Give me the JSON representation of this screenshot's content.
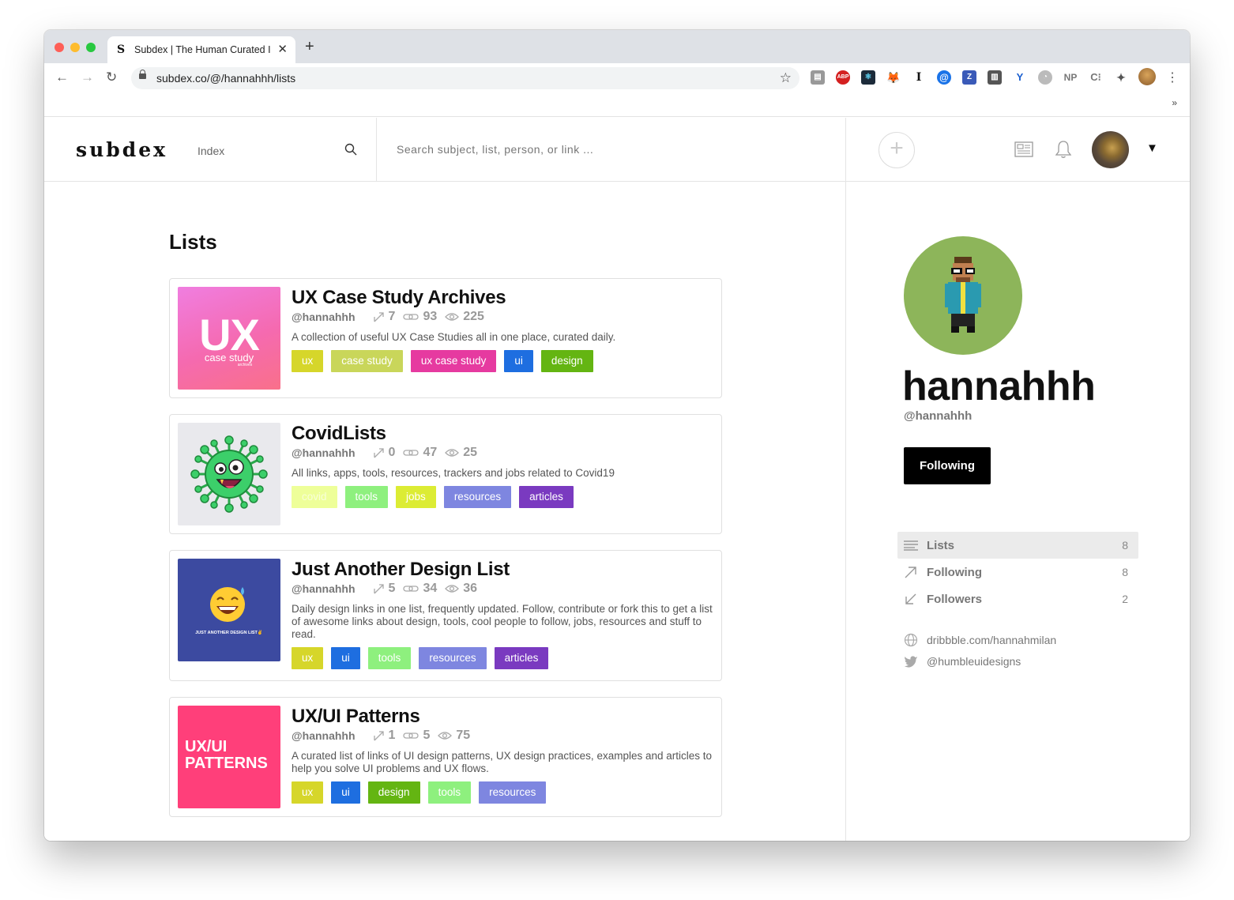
{
  "browser": {
    "tab_title": "Subdex | The Human Curated I",
    "tab_favicon": "S",
    "url": "subdex.co/@/hannahhh/lists",
    "extensions": [
      "suitcase-icon",
      "abp-icon",
      "react-icon",
      "metamask-icon",
      "instapaper-icon",
      "at-icon",
      "zotero-icon",
      "sidebar-icon",
      "y-icon",
      "ghost-icon",
      "np-icon",
      "c-icon",
      "puzzle-icon"
    ],
    "bookmarks_more": "»"
  },
  "header": {
    "logo": "subdex",
    "index_label": "Index",
    "search_placeholder": "Search subject, list, person, or link ...",
    "add_label": "+"
  },
  "main": {
    "heading": "Lists",
    "lists": [
      {
        "title": "UX Case Study Archives",
        "handle": "@hannahhh",
        "forks": "7",
        "links": "93",
        "views": "225",
        "description": "A collection of useful UX Case Studies all in one place, curated daily.",
        "thumb": {
          "big": "UX",
          "sub": "case study",
          "tiny": "archives"
        },
        "tags": [
          {
            "label": "ux",
            "color": "#d6d62a"
          },
          {
            "label": "case study",
            "color": "#c9d65a"
          },
          {
            "label": "ux case study",
            "color": "#e63aa0"
          },
          {
            "label": "ui",
            "color": "#1e6ee0"
          },
          {
            "label": "design",
            "color": "#64b512"
          }
        ]
      },
      {
        "title": "CovidLists",
        "handle": "@hannahhh",
        "forks": "0",
        "links": "47",
        "views": "25",
        "description": "All links, apps, tools, resources, trackers and jobs related to Covid19",
        "tags": [
          {
            "label": "covid",
            "color": "#eeff99"
          },
          {
            "label": "tools",
            "color": "#8ef07e"
          },
          {
            "label": "jobs",
            "color": "#dcec34"
          },
          {
            "label": "resources",
            "color": "#7e86e0"
          },
          {
            "label": "articles",
            "color": "#7a3ac0"
          }
        ]
      },
      {
        "title": "Just Another Design List",
        "handle": "@hannahhh",
        "forks": "5",
        "links": "34",
        "views": "36",
        "description": "Daily design links in one list, frequently updated. Follow, contribute or fork this to get a list of awesome links about design, tools, cool people to follow, jobs, resources and stuff to read.",
        "thumb": {
          "caption": "JUST ANOTHER DESIGN LIST✌"
        },
        "tags": [
          {
            "label": "ux",
            "color": "#d6d62a"
          },
          {
            "label": "ui",
            "color": "#1e6ee0"
          },
          {
            "label": "tools",
            "color": "#8ef07e"
          },
          {
            "label": "resources",
            "color": "#7e86e0"
          },
          {
            "label": "articles",
            "color": "#7a3ac0"
          }
        ]
      },
      {
        "title": "UX/UI Patterns",
        "handle": "@hannahhh",
        "forks": "1",
        "links": "5",
        "views": "75",
        "description": "A curated list of links of UI design patterns, UX design practices, examples and articles to help you solve UI problems and UX flows.",
        "thumb": {
          "line1": "UX/UI",
          "line2": "PATTERNS"
        },
        "tags": [
          {
            "label": "ux",
            "color": "#d6d62a"
          },
          {
            "label": "ui",
            "color": "#1e6ee0"
          },
          {
            "label": "design",
            "color": "#64b512"
          },
          {
            "label": "tools",
            "color": "#8ef07e"
          },
          {
            "label": "resources",
            "color": "#7e86e0"
          }
        ]
      }
    ]
  },
  "profile": {
    "name": "hannahhh",
    "handle": "@hannahhh",
    "follow_button": "Following",
    "nav": [
      {
        "label": "Lists",
        "count": "8",
        "active": true
      },
      {
        "label": "Following",
        "count": "8"
      },
      {
        "label": "Followers",
        "count": "2"
      }
    ],
    "website": "dribbble.com/hannahmilan",
    "twitter": "@humbleuidesigns"
  }
}
